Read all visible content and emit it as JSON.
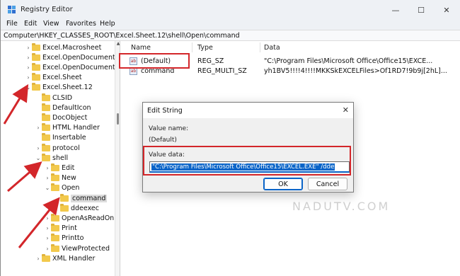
{
  "window": {
    "title": "Registry Editor",
    "minimize": "—",
    "maximize": "☐",
    "close": "✕"
  },
  "menu": [
    "File",
    "Edit",
    "View",
    "Favorites",
    "Help"
  ],
  "address": "Computer\\HKEY_CLASSES_ROOT\\Excel.Sheet.12\\shell\\Open\\command",
  "tree": [
    {
      "label": "Excel.Macrosheet",
      "chev": "›"
    },
    {
      "label": "Excel.OpenDocumentSp",
      "chev": "›"
    },
    {
      "label": "Excel.OpenDocumentSp",
      "chev": "›"
    },
    {
      "label": "Excel.Sheet",
      "chev": "›"
    },
    {
      "label": "Excel.Sheet.12",
      "chev": "⌄"
    },
    {
      "label": "CLSID",
      "chev": ""
    },
    {
      "label": "DefaultIcon",
      "chev": ""
    },
    {
      "label": "DocObject",
      "chev": ""
    },
    {
      "label": "HTML Handler",
      "chev": "›"
    },
    {
      "label": "Insertable",
      "chev": ""
    },
    {
      "label": "protocol",
      "chev": "›"
    },
    {
      "label": "shell",
      "chev": "⌄"
    },
    {
      "label": "Edit",
      "chev": "›"
    },
    {
      "label": "New",
      "chev": "›"
    },
    {
      "label": "Open",
      "chev": "⌄"
    },
    {
      "label": "command",
      "chev": ""
    },
    {
      "label": "ddeexec",
      "chev": "›"
    },
    {
      "label": "OpenAsReadOnly",
      "chev": "›"
    },
    {
      "label": "Print",
      "chev": "›"
    },
    {
      "label": "Printto",
      "chev": "›"
    },
    {
      "label": "ViewProtected",
      "chev": "›"
    },
    {
      "label": "XML Handler",
      "chev": "›"
    }
  ],
  "list": {
    "headers": [
      "Name",
      "Type",
      "Data"
    ],
    "rows": [
      {
        "name": "(Default)",
        "type": "REG_SZ",
        "data": "\"C:\\Program Files\\Microsoft Office\\Office15\\EXCE..."
      },
      {
        "name": "command",
        "type": "REG_MULTI_SZ",
        "data": "yh1BV5!!!!4!!!!MKKSkEXCELFiles>Of1RD7!9b9j[2hL]..."
      }
    ]
  },
  "dialog": {
    "title": "Edit String",
    "close": "✕",
    "value_name_label": "Value name:",
    "value_name": "(Default)",
    "value_data_label": "Value data:",
    "value_data": "\"C:\\Program Files\\Microsoft Office\\Office15\\EXCEL.EXE\" /dde",
    "ok_label": "OK",
    "cancel_label": "Cancel"
  },
  "watermark": "NADUTV.COM",
  "colors": {
    "annotation": "#d3262a",
    "selection": "#0a64c8",
    "folder": "#f2c94c"
  }
}
